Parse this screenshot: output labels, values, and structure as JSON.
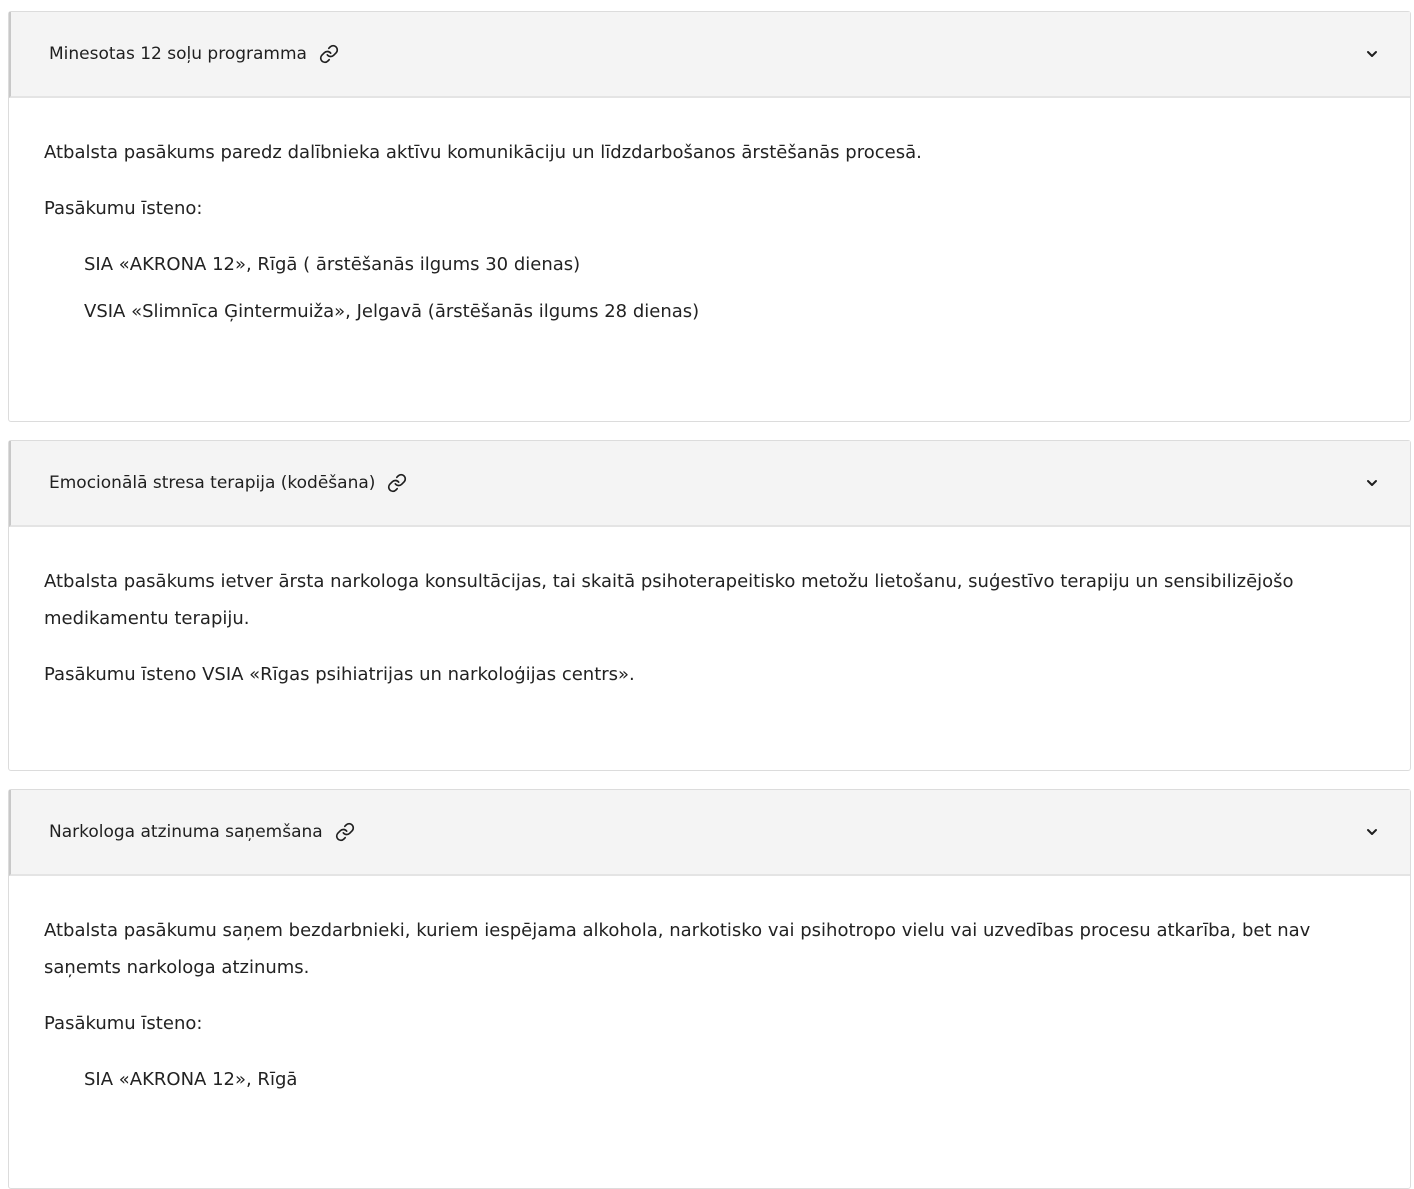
{
  "accordions": [
    {
      "title": "Minesotas 12 soļu programma",
      "paragraphs": [
        "Atbalsta pasākums paredz dalībnieka aktīvu komunikāciju un līdzdarbošanos ārstēšanās procesā.",
        "Pasākumu īsteno:"
      ],
      "items": [
        "SIA «AKRONA 12», Rīgā ( ārstēšanās ilgums 30 dienas)",
        "VSIA «Slimnīca Ģintermuiža», Jelgavā (ārstēšanās ilgums 28 dienas)"
      ]
    },
    {
      "title": "Emocionālā stresa terapija (kodēšana)",
      "paragraphs": [
        "Atbalsta pasākums ietver ārsta narkologa konsultācijas, tai skaitā psihoterapeitisko metožu lietošanu, suģestīvo terapiju un sensibilizējošo medikamentu terapiju.",
        "Pasākumu īsteno VSIA «Rīgas psihiatrijas un narkoloģijas centrs»."
      ]
    },
    {
      "title": "Narkologa atzinuma saņemšana",
      "paragraphs": [
        "Atbalsta pasākumu saņem bezdarbnieki, kuriem iespējama alkohola, narkotisko vai psihotropo vielu vai uzvedības procesu atkarība, bet nav saņemts narkologa atzinums.",
        "Pasākumu īsteno:"
      ],
      "items": [
        "SIA «AKRONA 12», Rīgā"
      ]
    }
  ],
  "icons": {
    "link": "link-icon",
    "expand": "chevron-down-icon"
  },
  "colors": {
    "header_bg": "#f4f4f4",
    "border": "#dcdcdc",
    "text": "#1f1f1f"
  }
}
